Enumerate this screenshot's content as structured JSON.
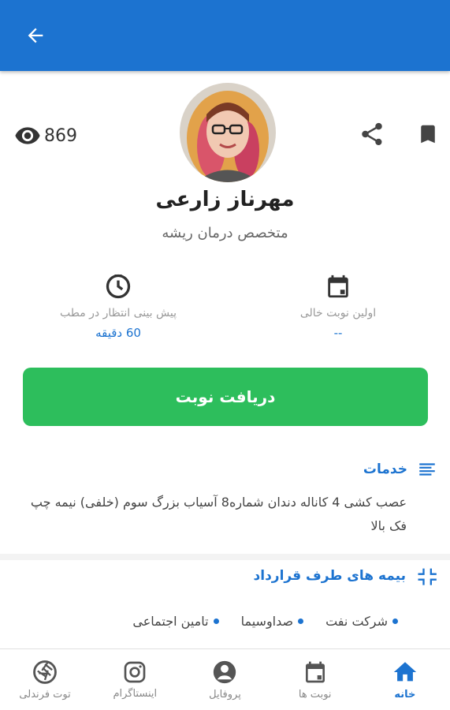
{
  "header": {
    "back_icon": "arrow-left-icon",
    "bg_color": "#1c73d0"
  },
  "profile": {
    "views": "869",
    "name": "مهرناز زارعی",
    "specialty": "متخصص درمان ریشه"
  },
  "stats": {
    "wait_label": "پیش بینی انتظار در مطب",
    "wait_value": "60 دقیقه",
    "first_label": "اولین نوبت خالی",
    "first_value": "--"
  },
  "cta": {
    "label": "دریافت نوبت",
    "color": "#2dbe5c"
  },
  "services": {
    "title": "خدمات",
    "text": "عصب کشی 4 کاناله دندان شماره8 آسیاب بزرگ سوم (خلفی) نیمه چپ فک بالا"
  },
  "insurance": {
    "title": "بیمه های طرف قرارداد",
    "items": [
      "شرکت نفت",
      "صداوسیما",
      "تامین اجتماعی"
    ]
  },
  "bottom_nav": [
    {
      "label": "خانه",
      "icon": "home-icon"
    },
    {
      "label": "نوبت ها",
      "icon": "calendar-icon"
    },
    {
      "label": "پروفایل",
      "icon": "account-icon"
    },
    {
      "label": "اینستاگرام",
      "icon": "instagram-icon"
    },
    {
      "label": "توت فرندلی",
      "icon": "aperture-icon"
    }
  ]
}
